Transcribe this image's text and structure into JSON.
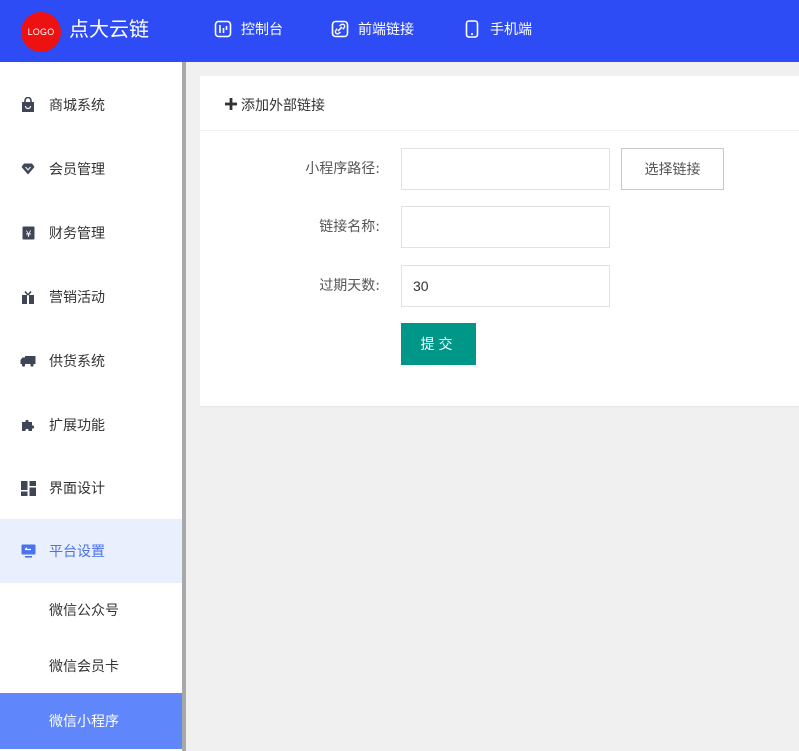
{
  "header": {
    "logo_text": "LOGO",
    "brand": "点大云链",
    "nav": [
      {
        "label": "控制台",
        "icon": "dashboard-icon"
      },
      {
        "label": "前端链接",
        "icon": "link-icon"
      },
      {
        "label": "手机端",
        "icon": "mobile-icon"
      }
    ]
  },
  "sidebar": {
    "items": [
      {
        "label": "商城系统",
        "icon": "shopping-bag-icon"
      },
      {
        "label": "会员管理",
        "icon": "diamond-icon"
      },
      {
        "label": "财务管理",
        "icon": "yen-icon"
      },
      {
        "label": "营销活动",
        "icon": "gift-icon"
      },
      {
        "label": "供货系统",
        "icon": "truck-icon"
      },
      {
        "label": "扩展功能",
        "icon": "puzzle-icon"
      },
      {
        "label": "界面设计",
        "icon": "layout-icon"
      },
      {
        "label": "平台设置",
        "icon": "monitor-icon"
      }
    ],
    "sub_items": [
      {
        "label": "微信公众号"
      },
      {
        "label": "微信会员卡"
      },
      {
        "label": "微信小程序"
      }
    ]
  },
  "card": {
    "title": "添加外部链接",
    "fields": {
      "path_label": "小程序路径:",
      "path_value": "",
      "select_link": "选择链接",
      "name_label": "链接名称:",
      "name_value": "",
      "expire_label": "过期天数:",
      "expire_value": "30"
    },
    "submit": "提交"
  },
  "colors": {
    "header_bg": "#2d4cf5",
    "submit_bg": "#009688",
    "active_sub_bg": "#5f86fa",
    "active_parent_bg": "#e9effd"
  }
}
